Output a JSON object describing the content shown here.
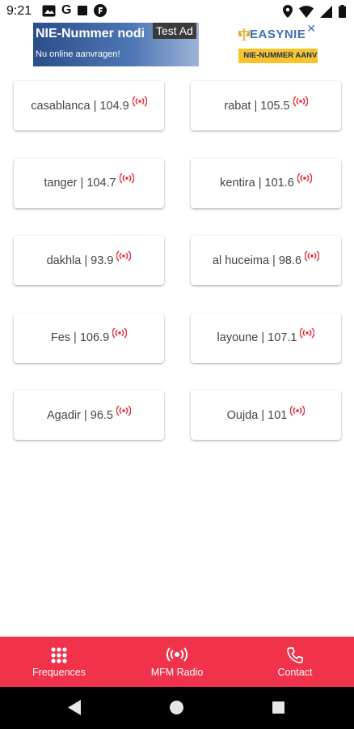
{
  "status_bar": {
    "time": "9:21",
    "left_icons": [
      "photo-icon",
      "google-icon",
      "stop-icon",
      "f-icon"
    ],
    "right_icons": [
      "location-icon",
      "wifi-icon",
      "signal-icon",
      "battery-icon"
    ]
  },
  "ad": {
    "title": "NIE-Nummer nodi",
    "subtitle": "Nu online aanvragen!",
    "test_label": "Test Ad",
    "brand": "EASYNIE",
    "cta": "NIE-NUMMER AANVRAGEN",
    "close": "✕"
  },
  "stations": [
    {
      "label": "casablanca | 104.9"
    },
    {
      "label": "rabat | 105.5"
    },
    {
      "label": "tanger | 104.7"
    },
    {
      "label": "kentira | 101.6"
    },
    {
      "label": "dakhla | 93.9"
    },
    {
      "label": "al huceima | 98.6"
    },
    {
      "label": "Fes | 106.9"
    },
    {
      "label": "layoune | 107.1"
    },
    {
      "label": "Agadir | 96.5"
    },
    {
      "label": "Oujda | 101"
    }
  ],
  "bottom_nav": {
    "items": [
      {
        "label": "Frequences",
        "icon": "grid-dots-icon"
      },
      {
        "label": "MFM Radio",
        "icon": "radio-broadcast-icon"
      },
      {
        "label": "Contact",
        "icon": "phone-icon"
      }
    ],
    "color": "#f0324a"
  },
  "system_nav": {
    "buttons": [
      "back-icon",
      "home-icon",
      "recents-icon"
    ]
  }
}
